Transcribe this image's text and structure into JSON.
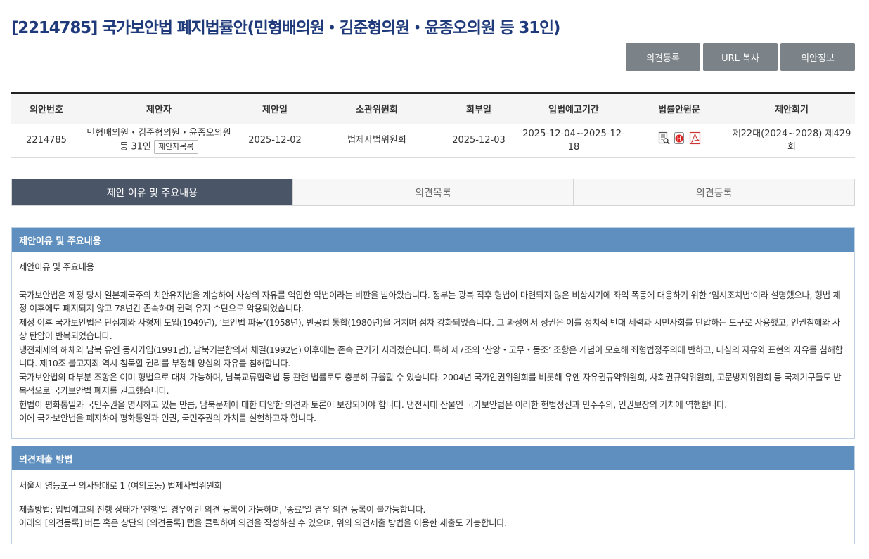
{
  "page": {
    "title": "[2214785] 국가보안법 폐지법률안(민형배의원・김준형의원・윤종오의원 등 31인)"
  },
  "actions": {
    "opinion_register": "의견등록",
    "url_copy": "URL 복사",
    "bill_info": "의안정보"
  },
  "info_table": {
    "headers": [
      "의안번호",
      "제안자",
      "제안일",
      "소관위원회",
      "회부일",
      "입법예고기간",
      "법률안원문",
      "제안회기"
    ],
    "row": {
      "bill_no": "2214785",
      "proposer": "민형배의원・김준형의원・윤종오의원 등 31인",
      "proposer_list_button": "제안자목록",
      "proposal_date": "2025-12-02",
      "committee": "법제사법위원회",
      "referral_date": "2025-12-03",
      "notice_period": "2025-12-04~2025-12-18",
      "original_text_icons": [
        "document-search-icon",
        "hwp-file-icon",
        "pdf-file-icon"
      ],
      "session": "제22대(2024~2028) 제429회"
    }
  },
  "tabs": [
    {
      "label": "제안 이유 및 주요내용",
      "active": true
    },
    {
      "label": "의견목록",
      "active": false
    },
    {
      "label": "의견등록",
      "active": false
    }
  ],
  "reason_panel": {
    "header": "제안이유 및 주요내용",
    "subtitle": "제안이유 및 주요내용",
    "paragraphs": [
      "국가보안법은 제정 당시 일본제국주의 치안유지법을 계승하여 사상의 자유를 억압한 악법이라는 비판을 받아왔습니다. 정부는 광복 직후 형법이 마련되지 않은 비상시기에 좌익 폭동에 대응하기 위한 ‘임시조치법’이라 설명했으나, 형법 제정 이후에도 폐지되지 않고 78년간 존속하며 권력 유지 수단으로 악용되었습니다.",
      "제정 이후 국가보안법은 단심제와 사형제 도입(1949년), ‘보안법 파동’(1958년), 반공법 통합(1980년)을 거치며 점차 강화되었습니다. 그 과정에서 정권은 이를 정치적 반대 세력과 시민사회를 탄압하는 도구로 사용했고, 인권침해와 사상 탄압이 반복되었습니다.",
      "냉전체제의 해체와 남북 유엔 동시가입(1991년), 남북기본합의서 체결(1992년) 이후에는 존속 근거가 사라졌습니다. 특히 제7조의 ‘찬양・고무・동조’ 조항은 개념이 모호해 죄형법정주의에 반하고, 내심의 자유와 표현의 자유를 침해합니다. 제10조 불고지죄 역시 침묵할 권리를 부정해 양심의 자유를 침해합니다.",
      "국가보안법의 대부분 조항은 이미 형법으로 대체 가능하며, 남북교류협력법 등 관련 법률로도 충분히 규율할 수 있습니다. 2004년 국가인권위원회를 비롯해 유엔 자유권규약위원회, 사회권규약위원회, 고문방지위원회 등 국제기구들도 반복적으로 국가보안법 폐지를 권고했습니다.",
      "헌법이 평화통일과 국민주권을 명시하고 있는 만큼, 남북문제에 대한 다양한 의견과 토론이 보장되어야 합니다. 냉전시대 산물인 국가보안법은 이러한 헌법정신과 민주주의, 인권보장의 가치에 역행합니다.",
      "이에 국가보안법을 폐지하여 평화통일과 인권, 국민주권의 가치를 실현하고자 합니다."
    ]
  },
  "submission_panel": {
    "header": "의견제출 방법",
    "address": "서울시 영등포구 의사당대로 1 (여의도동) 법제사법위원회",
    "method_line": "제출방법: 입법예고의 진행 상태가 '진행'일 경우에만 의견 등록이 가능하며, '종료'일 경우 의견 등록이 불가능합니다.",
    "guide_line": "아래의 [의견등록] 버튼 혹은 상단의 [의견등록] 탭을 클릭하여 의견을 작성하실 수 있으며, 위의 의견제출 방법을 이용한 제출도 가능합니다."
  }
}
